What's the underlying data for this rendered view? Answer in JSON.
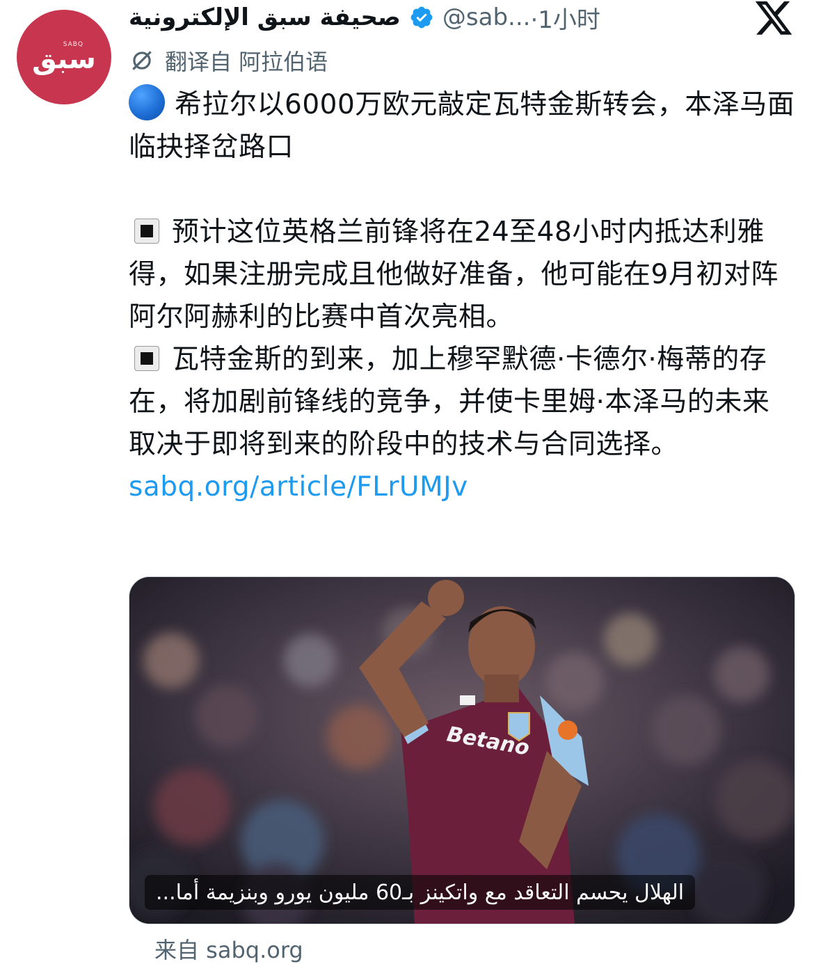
{
  "tweet": {
    "author": {
      "display_name": "صحيفة سبق الإلكترونية",
      "handle": "@sab...",
      "verified": true,
      "avatar_logo_small": "SABQ",
      "avatar_logo_main": "سبق",
      "avatar_color": "#c8354e"
    },
    "time": "·1小时",
    "platform_icon": "x-logo-icon",
    "translated_label": "翻译自 阿拉伯语",
    "paragraphs": [
      "希拉尔以6000万欧元敲定瓦特金斯转会，本泽马面临抉择岔路口",
      "预计这位英格兰前锋将在24至48小时内抵达利雅得，如果注册完成且他做好准备，他可能在9月初对阵阿尔阿赫利的比赛中首次亮相。",
      "瓦特金斯的到来，加上穆罕默德·卡德尔·梅蒂的存在，将加剧前锋线的竞争，并使卡里姆·本泽马的未来取决于即将到来的阶段中的技术与合同选择。"
    ],
    "link": "sabq.org/article/FLrUMJv",
    "card": {
      "image_alt": "footballer-celebrating-photo",
      "caption": "الهلال يحسم التعاقد مع واتكينز بـ60 مليون يورو وبنزيمة أما..."
    },
    "source_label": "来自 sabq.org"
  },
  "colors": {
    "link": "#1d9bf0",
    "secondary_text": "#536471",
    "verified": "#1d9bf0"
  }
}
